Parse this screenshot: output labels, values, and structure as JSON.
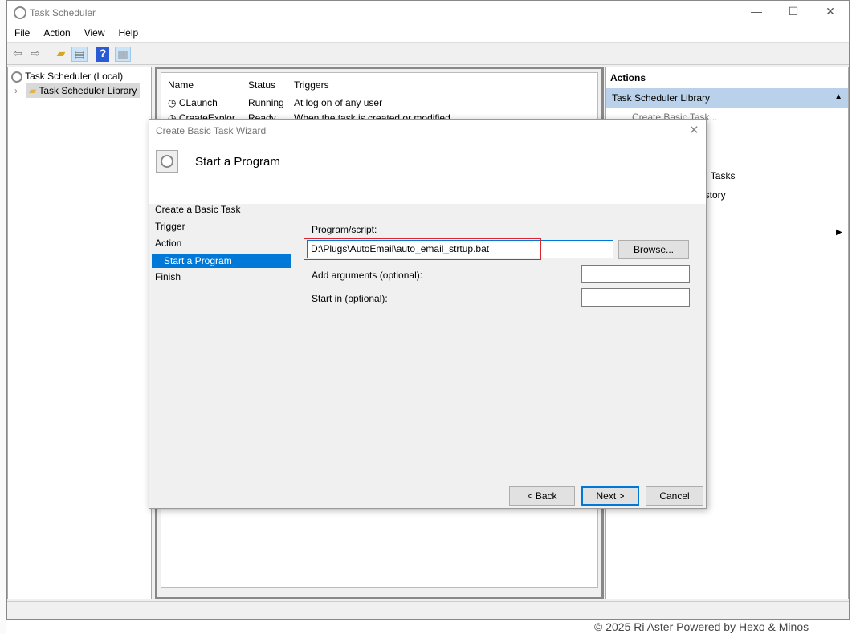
{
  "window": {
    "title": "Task Scheduler",
    "minimize": "—",
    "maximize": "☐",
    "close": "✕"
  },
  "menu": [
    "File",
    "Action",
    "View",
    "Help"
  ],
  "tree": {
    "root": "Task Scheduler (Local)",
    "library": "Task Scheduler Library"
  },
  "list": {
    "columns": [
      "Name",
      "Status",
      "Triggers"
    ],
    "rows": [
      {
        "name": "CLaunch",
        "status": "Running",
        "trigger": "At log on of any user"
      },
      {
        "name": "CreateExplor...",
        "status": "Ready",
        "trigger": "When the task is created or modified"
      }
    ]
  },
  "actions": {
    "header": "Actions",
    "section": "Task Scheduler Library",
    "items": [
      "Create Basic Task...",
      "g Tasks",
      "istory"
    ]
  },
  "dialog": {
    "title": "Create Basic Task Wizard",
    "heading": "Start a Program",
    "steps": [
      "Create a Basic Task",
      "Trigger",
      "Action",
      "Start a Program",
      "Finish"
    ],
    "program_label": "Program/script:",
    "program_value": "D:\\Plugs\\AutoEmail\\auto_email_strtup.bat",
    "browse": "Browse...",
    "args_label": "Add arguments (optional):",
    "args_value": "",
    "startin_label": "Start in (optional):",
    "startin_value": "",
    "back": "< Back",
    "next": "Next >",
    "cancel": "Cancel",
    "highlight_color": "#d9262e"
  },
  "background": {
    "footer": "© 2025 Ri Aster Powered by Hexo & Minos"
  }
}
